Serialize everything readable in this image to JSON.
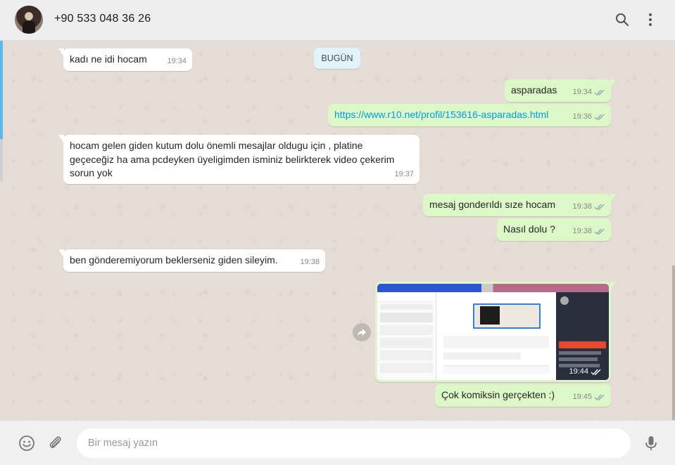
{
  "header": {
    "contact_name": "+90 533 048 36 26",
    "icons": [
      "avatar",
      "search-icon",
      "menu-icon"
    ]
  },
  "chat": {
    "date_divider": "BUGÜN",
    "messages": [
      {
        "direction": "in",
        "text": "kadı ne idi hocam",
        "time": "19:34"
      },
      {
        "direction": "out",
        "text": "asparadas",
        "time": "19:34",
        "status": "read"
      },
      {
        "direction": "out",
        "text": "https://www.r10.net/profil/153616-asparadas.html",
        "time": "19:36",
        "status": "read",
        "is_link": true
      },
      {
        "direction": "in",
        "text": "hocam gelen giden kutum dolu önemli mesajlar oldugu için , platine geçeceğiz ha ama pcdeyken üyeligimden isminiz belirkterek video çekerim sorun yok",
        "time": "19:37"
      },
      {
        "direction": "out",
        "text": "mesaj gonderıldı sıze hocam",
        "time": "19:38",
        "status": "read"
      },
      {
        "direction": "out",
        "text": "Nasıl dolu ?",
        "time": "19:38",
        "status": "read"
      },
      {
        "direction": "in",
        "text": "ben gönderemiyorum beklerseniz giden sileyim.",
        "time": "19:38"
      },
      {
        "direction": "out",
        "type": "image",
        "time": "19:44",
        "status": "read"
      },
      {
        "direction": "out",
        "text": "Çok komiksin gerçekten :)",
        "time": "19:45",
        "status": "read"
      }
    ]
  },
  "composer": {
    "placeholder": "Bir mesaj yazın",
    "value": ""
  },
  "colors": {
    "incoming_bubble": "#ffffff",
    "outgoing_bubble": "#dcf8c6",
    "chat_background": "#e5ddd5",
    "link": "#039be5",
    "date_chip": "#e1f3fb"
  }
}
